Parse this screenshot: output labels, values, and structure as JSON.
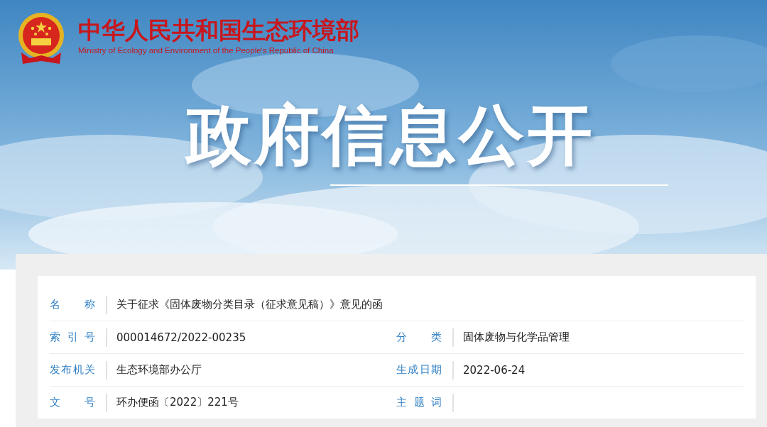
{
  "header": {
    "title": "中华人民共和国生态环境部",
    "subtitle": "Ministry of Ecology and Environment of the People's Republic of China"
  },
  "banner": {
    "heading": "政府信息公开"
  },
  "info_table": {
    "rows": [
      [
        {
          "label": "名称",
          "value": "关于征求《固体废物分类目录（征求意见稿）》意见的函"
        }
      ],
      [
        {
          "label": "索引号",
          "value": "000014672/2022-00235"
        },
        {
          "label": "分类",
          "value": "固体废物与化学品管理"
        }
      ],
      [
        {
          "label": "发布机关",
          "value": "生态环境部办公厅"
        },
        {
          "label": "生成日期",
          "value": "2022-06-24"
        }
      ],
      [
        {
          "label": "文号",
          "value": "环办便函〔2022〕221号"
        },
        {
          "label": "主题词"
        }
      ]
    ]
  }
}
